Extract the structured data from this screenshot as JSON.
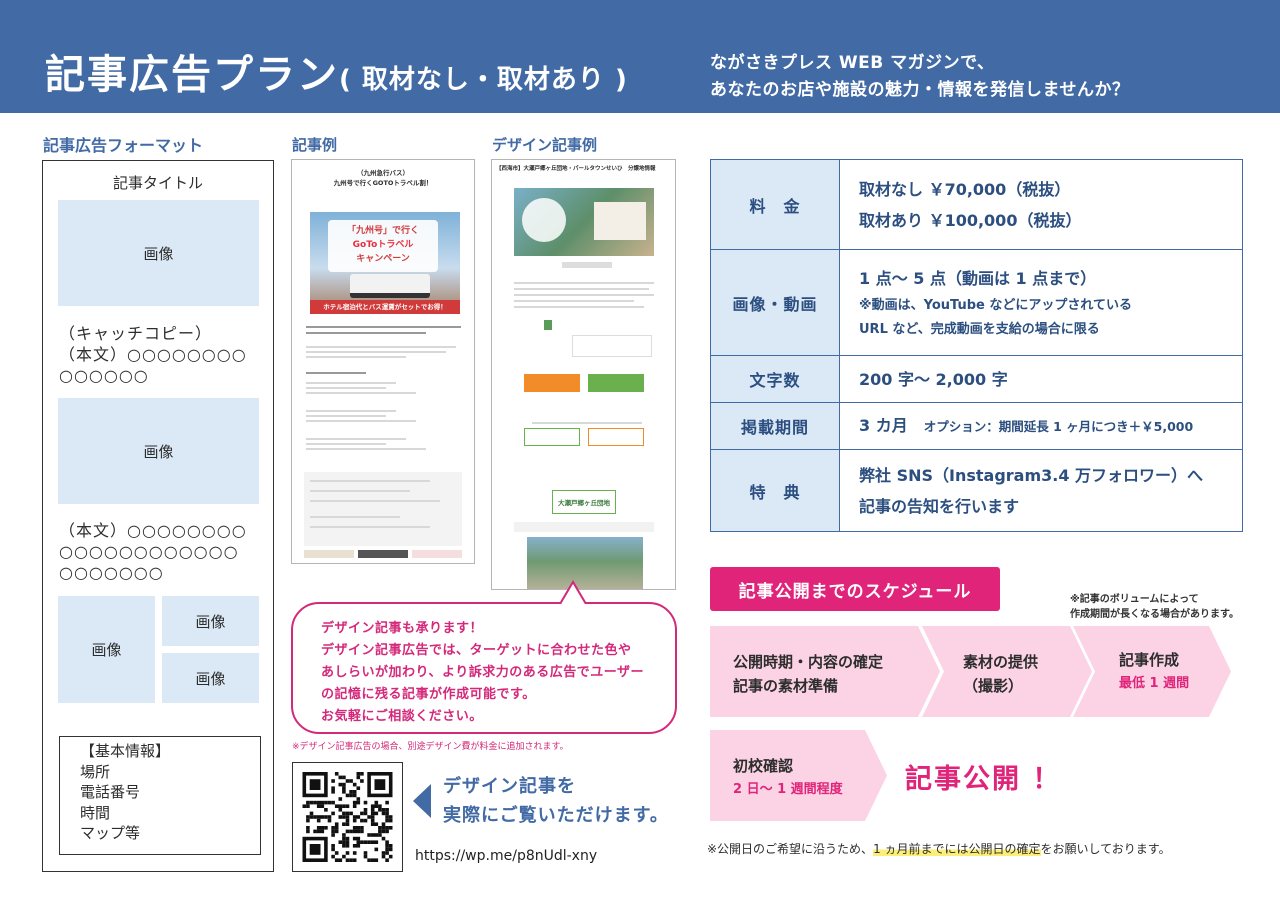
{
  "header": {
    "title": "記事広告プラン",
    "subtitle": "( 取材なし・取材あり )",
    "tagline_1": "ながさきプレス WEB マガジンで、",
    "tagline_2": "あなたのお店や施設の魅力・情報を発信しませんか？"
  },
  "format": {
    "heading": "記事広告フォーマット",
    "article_title": "記事タイトル",
    "image_label": "画像",
    "catch_1": "（キャッチコピー）",
    "catch_2": "（本文）○○○○○○○○",
    "catch_3": "○○○○○○",
    "body_1": "（本文）○○○○○○○○",
    "body_2": "○○○○○○○○○○○○",
    "body_3": "○○○○○○○",
    "basic_1": "【基本情報】",
    "basic_2": "場所",
    "basic_3": "電話番号",
    "basic_4": "時間",
    "basic_5": "マップ等"
  },
  "example": {
    "heading": "記事例",
    "mini_title_1": "（九州急行バス）",
    "mini_title_2": "九州号で行くGOTOトラベル割！",
    "banner_1": "「九州号」で行く",
    "banner_2": "GoToトラベル",
    "banner_3": "キャンペーン",
    "banner_strip": "ホテル宿泊代とバス運賃がセットでお得！"
  },
  "design": {
    "heading": "デザイン記事例",
    "mini_title": "【西海市】大瀬戸郷ヶ丘団地・パールタウンせいひ　分譲地情報",
    "photo_text": "大瀬戸郷ヶ丘団地"
  },
  "bubble": {
    "line_1": "デザイン記事も承ります！",
    "line_2": "デザイン記事広告では、ターゲットに合わせた色や",
    "line_3": "あしらいが加わり、より訴求力のある広告でユーザー",
    "line_4": "の記憶に残る記事が作成可能です。",
    "line_5": "お気軽にご相談ください。",
    "note": "※デザイン記事広告の場合、別途デザイン費が料金に追加されます。"
  },
  "qr": {
    "text_1": "デザイン記事を",
    "text_2": "実際にご覧いただけます。",
    "url": "https://wp.me/p8nUdl-xny"
  },
  "price_table": {
    "fee_label": "料　金",
    "fee_1": "取材なし ￥70,000（税抜）",
    "fee_2": "取材あり ￥100,000（税抜）",
    "media_label": "画像・動画",
    "media_1": "1 点～ 5 点（動画は 1 点まで）",
    "media_2": "※動画は、YouTube などにアップされている",
    "media_3": "URL など、完成動画を支給の場合に限る",
    "chars_label": "文字数",
    "chars": "200 字～ 2,000 字",
    "period_label": "掲載期間",
    "period": "3 カ月",
    "period_option": "オプション：期間延長 1 ヶ月につき＋￥5,000",
    "perk_label": "特　典",
    "perk_1": "弊社 SNS（Instagram3.4 万フォロワー）へ",
    "perk_2": "記事の告知を行います"
  },
  "schedule": {
    "heading": "記事公開までのスケジュール",
    "note_1": "※記事のボリュームによって",
    "note_2": "作成期間が長くなる場合があります。",
    "step1_1": "公開時期・内容の確定",
    "step1_2": "記事の素材準備",
    "step2_1": "素材の提供",
    "step2_2": "（撮影）",
    "step3_1": "記事作成",
    "step3_2": "最低 1 週間",
    "step4_1": "初校確認",
    "step4_2": "2 日～ 1 週間程度",
    "publish": "記事公開 ！",
    "foot_1": "※公開日のご希望に沿うため、",
    "foot_hl": "1 ヵ月前までには公開日の確定",
    "foot_2": "をお願いしております。"
  },
  "colors": {
    "brand_blue": "#426aa5",
    "light_blue": "#dbe9f6",
    "magenta": "#e0247a",
    "pink": "#fbd3e5"
  }
}
